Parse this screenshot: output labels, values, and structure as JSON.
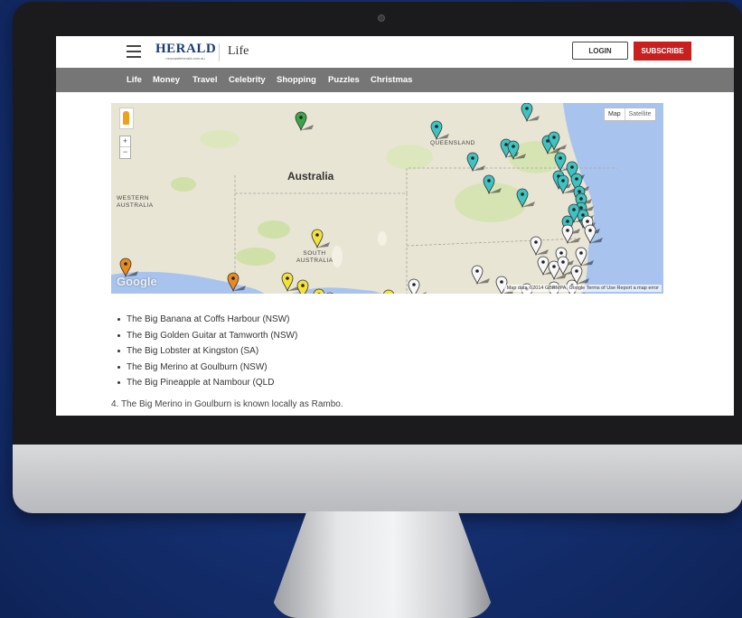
{
  "header": {
    "logo_text": "HERALD",
    "logo_sub": "newcastleherald.com.au",
    "section": "Life",
    "login_label": "LOGIN",
    "subscribe_label": "SUBSCRIBE",
    "accent_color": "#c8201f"
  },
  "nav": {
    "items": [
      {
        "label": "Life"
      },
      {
        "label": "Money"
      },
      {
        "label": "Travel"
      },
      {
        "label": "Celebrity"
      },
      {
        "label": "Shopping"
      },
      {
        "label": "Puzzles"
      },
      {
        "label": "Christmas"
      }
    ]
  },
  "map": {
    "labels": {
      "country": "Australia",
      "queensland": "QUEENSLAND",
      "western_australia": "WESTERN AUSTRALIA",
      "south_australia": "SOUTH AUSTRALIA"
    },
    "map_type": [
      "Map",
      "Satellite"
    ],
    "zoom": [
      "+",
      "−"
    ],
    "google": "Google",
    "attribution": "Map data ©2014 GBRMPA, Google   Terms of Use   Report a map error",
    "marker_colors": {
      "green": "#3aa64a",
      "teal": "#3fc2c2",
      "yellow": "#f3e23a",
      "orange": "#e88b1e",
      "white": "#f7f7f7"
    }
  },
  "content": {
    "list": [
      "The Big Banana at Coffs Harbour (NSW)",
      "The Big Golden Guitar at Tamworth (NSW)",
      "The Big Lobster at Kingston (SA)",
      "The Big Merino at Goulburn (NSW)",
      "The Big Pineapple at Nambour (QLD"
    ],
    "fact": "4. The Big Merino in Goulburn is known locally as Rambo."
  }
}
